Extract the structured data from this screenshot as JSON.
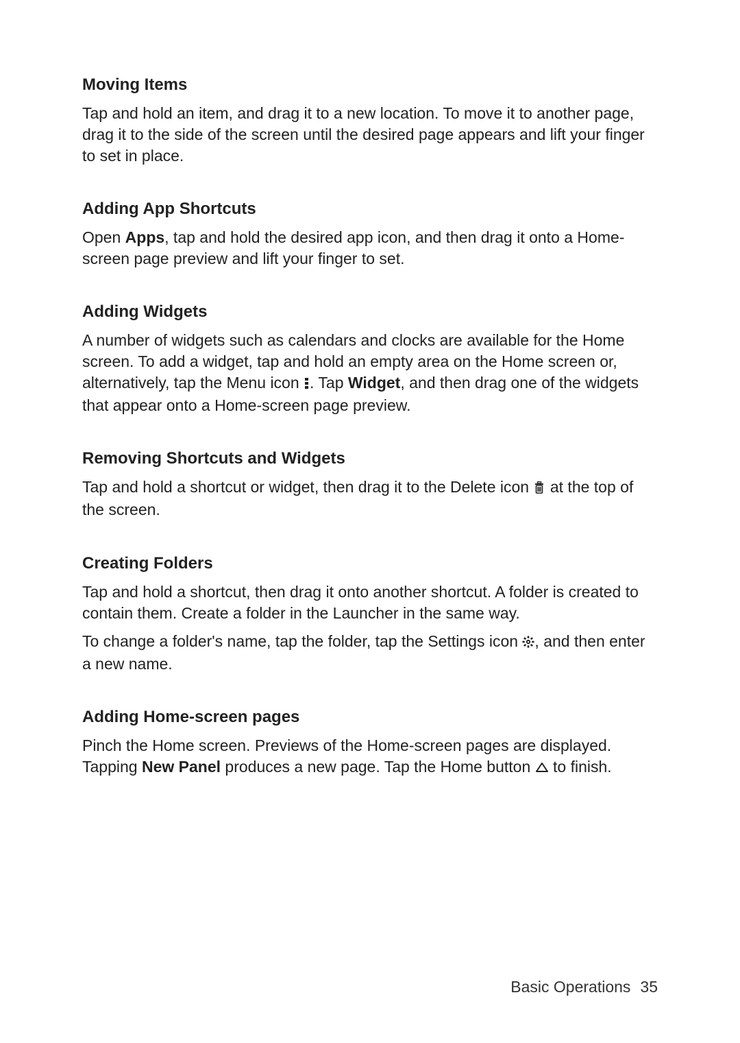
{
  "sections": {
    "s1": {
      "heading": "Moving Items",
      "p1": "Tap and hold an item, and drag it to a new location. To move it to another page, drag it to the side of the screen until the desired page appears and lift your finger to set in place."
    },
    "s2": {
      "heading": "Adding App Shortcuts",
      "p1a": "Open ",
      "p1b": "Apps",
      "p1c": ", tap and hold the desired app icon, and then drag it onto a Home-screen page preview and lift your finger to set."
    },
    "s3": {
      "heading": "Adding Widgets",
      "p1a": "A number of widgets such as calendars and clocks are available for the Home screen. To add a widget, tap and hold an empty area on the Home screen or, alternatively, tap the Menu icon ",
      "p1b": ". Tap ",
      "p1c": "Widget",
      "p1d": ", and then drag one of the widgets that appear onto a Home-screen page preview."
    },
    "s4": {
      "heading": "Removing Shortcuts and Widgets",
      "p1a": "Tap and hold a shortcut or widget, then drag it to the Delete icon ",
      "p1b": " at the top of the screen."
    },
    "s5": {
      "heading": "Creating Folders",
      "p1": "Tap and hold a shortcut, then drag it onto another shortcut. A folder is created to contain them. Create a folder in the Launcher in the same way.",
      "p2a": "To change a folder's name, tap the folder, tap the Settings icon ",
      "p2b": ", and then enter a new name."
    },
    "s6": {
      "heading": "Adding Home-screen pages",
      "p1a": "Pinch the Home screen. Previews of the Home-screen pages are displayed. Tapping ",
      "p1b": "New Panel",
      "p1c": " produces a new page. Tap the Home button ",
      "p1d": " to finish."
    }
  },
  "footer": {
    "chapter": "Basic Operations",
    "page": "35"
  }
}
